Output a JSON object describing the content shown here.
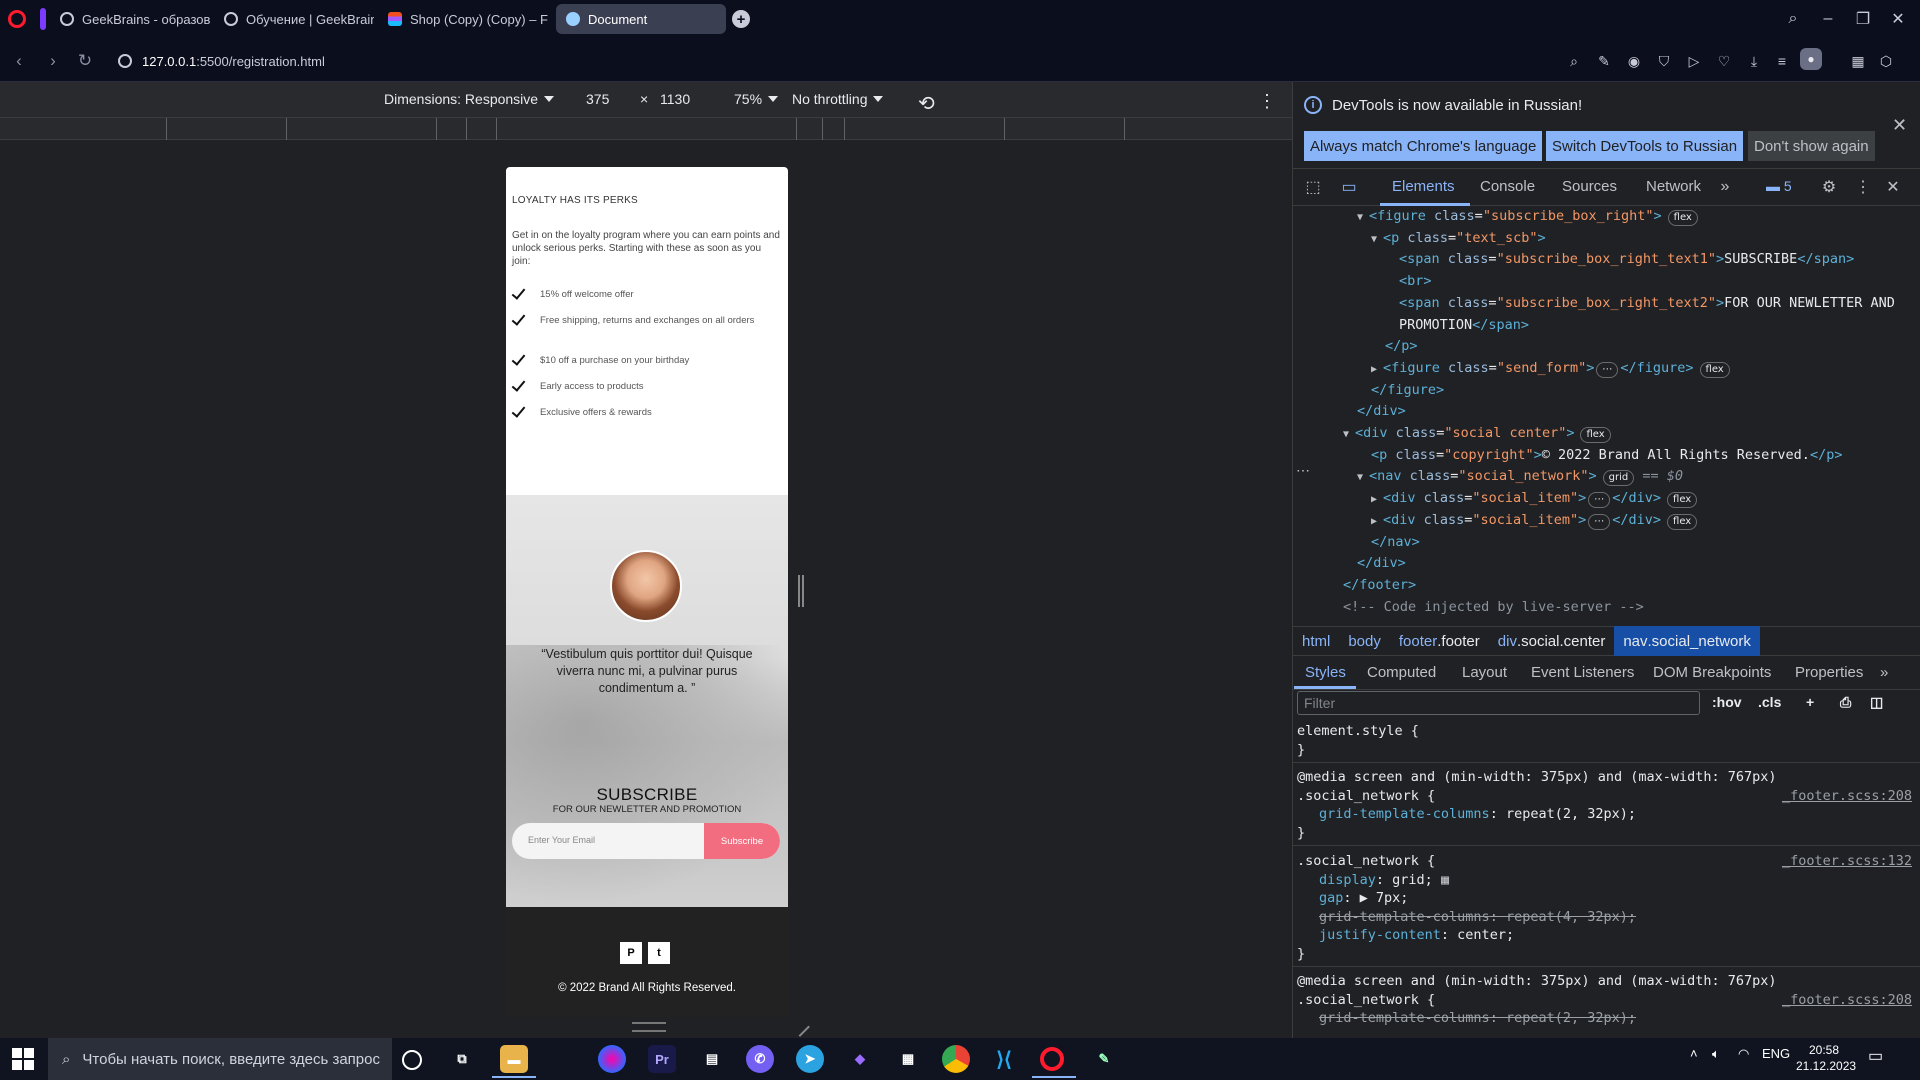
{
  "browser": {
    "tabs": [
      {
        "label": "GeekBrains - образовате"
      },
      {
        "label": "Обучение | GeekBrains -"
      },
      {
        "label": "Shop (Copy) (Copy) – Fig"
      },
      {
        "label": "Document"
      }
    ],
    "url_host": "127.0.0.1",
    "url_path": ":5500/registration.html"
  },
  "device_toolbar": {
    "dimensions_label": "Dimensions: Responsive",
    "width": "375",
    "times": "×",
    "height": "1130",
    "zoom": "75%",
    "throttling": "No throttling"
  },
  "page": {
    "perks_title": "LOYALTY HAS ITS PERKS",
    "perks_desc": "Get in on the loyalty program where you can earn points and unlock serious perks. Starting with these as soon as you join:",
    "perks": [
      "15% off welcome offer",
      "Free shipping, returns and exchanges on all orders",
      "$10 off a purchase on your birthday",
      "Early access to products",
      "Exclusive offers & rewards"
    ],
    "quote": "“Vestibulum quis porttitor dui! Quisque viverra nunc mi, a pulvinar purus condimentum a. ”",
    "subscribe_title": "SUBSCRIBE",
    "subscribe_sub": "FOR OUR NEWLETTER AND PROMOTION",
    "email_placeholder": "Enter Your Email",
    "subscribe_button": "Subscribe",
    "social": [
      "P",
      "t"
    ],
    "copyright": "© 2022 Brand All Rights Reserved."
  },
  "devtools": {
    "notice": "DevTools is now available in Russian!",
    "btn_match": "Always match Chrome's language",
    "btn_switch": "Switch DevTools to Russian",
    "btn_dismiss": "Don't show again",
    "tabs": [
      "Elements",
      "Console",
      "Sources",
      "Network"
    ],
    "message_count": "5",
    "breadcrumbs": [
      {
        "tag": "html",
        "cls": ""
      },
      {
        "tag": "body",
        "cls": ""
      },
      {
        "tag": "footer",
        "cls": ".footer"
      },
      {
        "tag": "div",
        "cls": ".social.center"
      },
      {
        "tag": "nav",
        "cls": ".social_network"
      }
    ],
    "style_tabs": [
      "Styles",
      "Computed",
      "Layout",
      "Event Listeners",
      "DOM Breakpoints",
      "Properties"
    ],
    "filter_placeholder": "Filter",
    "hov": ":hov",
    "cls": ".cls",
    "elements": {
      "l1a": "<figure ",
      "l1b": "class",
      "l1c": "\"subscribe_box_right\"",
      "l1d": ">",
      "l2a": "<p ",
      "l2b": "class",
      "l2c": "\"text_scb\"",
      "l2d": ">",
      "l3a": "<span ",
      "l3b": "class",
      "l3c": "\"subscribe_box_right_text1\"",
      "l3d": ">",
      "l3e": "SUBSCRIBE",
      "l3f": "</span>",
      "l4": "<br>",
      "l5a": "<span ",
      "l5b": "class",
      "l5c": "\"subscribe_box_right_text2\"",
      "l5d": ">",
      "l5e": "FOR OUR NEWLETTER AND",
      "l6a": "PROMOTION",
      "l6b": "</span>",
      "l7": "</p>",
      "l8a": "<figure ",
      "l8b": "class",
      "l8c": "\"send_form\"",
      "l8d": ">",
      "l8e": "⋯",
      "l8f": "</figure>",
      "l9": "</figure>",
      "l10": "</div>",
      "l11a": "<div ",
      "l11b": "class",
      "l11c": "\"social center\"",
      "l11d": ">",
      "l12a": "<p ",
      "l12b": "class",
      "l12c": "\"copyright\"",
      "l12d": ">",
      "l12e": "© 2022 Brand All Rights Reserved.",
      "l12f": "</p>",
      "l13a": "<nav ",
      "l13b": "class",
      "l13c": "\"social_network\"",
      "l13d": ">",
      "l13e": "== $0",
      "l14a": "<div ",
      "l14b": "class",
      "l14c": "\"social_item\"",
      "l14d": ">",
      "l14e": "⋯",
      "l14f": "</div>",
      "l15a": "<div ",
      "l15b": "class",
      "l15c": "\"social_item\"",
      "l15d": ">",
      "l15e": "⋯",
      "l15f": "</div>",
      "l16": "</nav>",
      "l17": "</div>",
      "l18": "</footer>",
      "l19": "<!-- Code injected by live-server -->",
      "pill_flex": "flex",
      "pill_grid": "grid"
    },
    "styles": {
      "s1": "element.style {",
      "s2": "}",
      "s3": "@media screen and (min-width: 375px) and (max-width: 767px)",
      "s4": ".social_network {",
      "s4src": "_footer.scss:208",
      "s5p": "grid-template-columns",
      "s5v": ": repeat(2, 32px);",
      "s6": "}",
      "s7": ".social_network {",
      "s7src": "_footer.scss:132",
      "s8p": "display",
      "s8v": ": grid;",
      "s9p": "gap",
      "s9v": ": ▶ 7px;",
      "s10p": "grid-template-columns",
      "s10v": ": repeat(4, 32px);",
      "s11p": "justify-content",
      "s11v": ": center;",
      "s12": "}",
      "s13": "@media screen and (min-width: 375px) and (max-width: 767px)",
      "s14": ".social_network {",
      "s14src": "_footer.scss:208",
      "s15p": "grid-template-columns",
      "s15v": ": repeat(2, 32px);"
    }
  },
  "taskbar": {
    "search_placeholder": "Чтобы начать поиск, введите здесь запрос",
    "lang": "ENG",
    "time": "20:58",
    "date": "21.12.2023"
  }
}
